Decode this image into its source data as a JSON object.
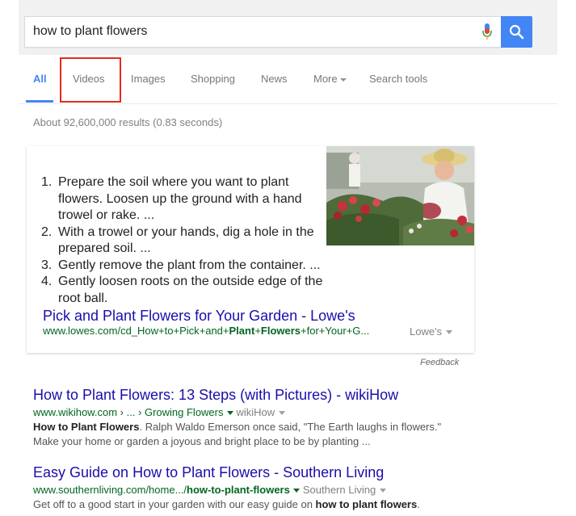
{
  "search": {
    "query": "how to plant flowers"
  },
  "tabs": [
    {
      "label": "All"
    },
    {
      "label": "Videos"
    },
    {
      "label": "Images"
    },
    {
      "label": "Shopping"
    },
    {
      "label": "News"
    },
    {
      "label": "More"
    },
    {
      "label": "Search tools"
    }
  ],
  "result_stats": "About 92,600,000 results (0.83 seconds)",
  "featured": {
    "steps": [
      {
        "num": "1.",
        "text": "Prepare the soil where you want to plant flowers. Loosen up the ground with a hand trowel or rake. ..."
      },
      {
        "num": "2.",
        "text": "With a trowel or your hands, dig a hole in the prepared soil. ..."
      },
      {
        "num": "3.",
        "text": "Gently remove the plant from the container. ..."
      },
      {
        "num": "4.",
        "text": "Gently loosen roots on the outside edge of the root ball."
      }
    ],
    "link_title": "Pick and Plant Flowers for Your Garden - Lowe's",
    "url_pre": "www.lowes.com/cd_How+to+Pick+and+",
    "url_b1": "Plant",
    "url_mid": "+",
    "url_b2": "Flowers",
    "url_post": "+for+Your+G...",
    "source": "Lowe's",
    "feedback": "Feedback"
  },
  "results": [
    {
      "title": "How to Plant Flowers: 13 Steps (with Pictures) - wikiHow",
      "url": "www.wikihow.com › ... › Growing Flowers",
      "source": "wikiHow",
      "snippet_b1": "How to Plant Flowers",
      "snippet_line1": ". Ralph Waldo Emerson once said, \"The Earth laughs in flowers.\"",
      "snippet_line2": "Make your home or garden a joyous and bright place to be by planting ..."
    },
    {
      "title": "Easy Guide on How to Plant Flowers - Southern Living",
      "url_pre": "www.southernliving.com/home.../",
      "url_b": "how-to-plant-flowers",
      "source": "Southern Living",
      "snippet_pre": "Get off to a good start in your garden with our easy guide on ",
      "snippet_b": "how to plant flowers",
      "snippet_post": "."
    }
  ],
  "colors": {
    "accent": "#4285f4",
    "link": "#1a0dab",
    "url": "#006621",
    "highlight": "#e8291c"
  }
}
